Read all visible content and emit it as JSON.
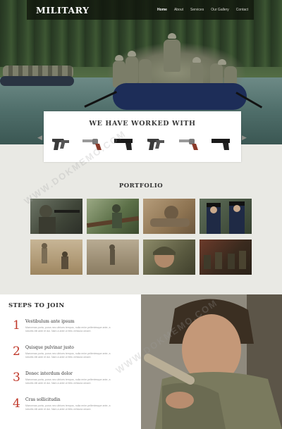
{
  "brand": "MILITARY",
  "nav": {
    "items": [
      "Home",
      "About",
      "Services",
      "Our Gallery",
      "Contact"
    ],
    "active_index": 0
  },
  "partners": {
    "title": "WE HAVE WORKED WITH",
    "logos": [
      "holster-pistol-icon",
      "revolver-icon",
      "pistol-icon",
      "holster-pistol-icon",
      "revolver-icon",
      "pistol-icon"
    ]
  },
  "portfolio": {
    "title": "PORTFOLIO",
    "thumbnails": [
      "soldier-aiming",
      "soldiers-forest",
      "soldier-crawling",
      "honor-guard",
      "desert-soldiers",
      "soldier-in-dust",
      "soldier-closeup",
      "troops-in-field"
    ]
  },
  "steps": {
    "title": "STEPS TO JOIN",
    "items": [
      {
        "num": "1",
        "title": "Vestibulum ante ipsum",
        "text": "Maecenas porta, purus nec ultrices tempus, nulla enim pellentesque ante, a lobortis elit ante et dui. Nam a ante ut felis vehicula ornare."
      },
      {
        "num": "2",
        "title": "Quisque pulvinar justo",
        "text": "Maecenas porta, purus nec ultrices tempus, nulla enim pellentesque ante, a lobortis elit ante et dui. Nam a ante ut felis vehicula ornare."
      },
      {
        "num": "3",
        "title": "Donec interdum dolor",
        "text": "Maecenas porta, purus nec ultrices tempus, nulla enim pellentesque ante, a lobortis elit ante et dui. Nam a ante ut felis vehicula ornare."
      },
      {
        "num": "4",
        "title": "Cras sollicitudin",
        "text": "Maecenas porta, purus nec ultrices tempus, nulla enim pellentesque ante, a lobortis elit ante et dui. Nam a ante ut felis vehicula ornare."
      }
    ]
  },
  "watermark": "WWW.DOKMEMO.COM",
  "colors": {
    "accent": "#c0392b",
    "nav_bg": "#1a2114",
    "section_bg": "#e9e9e4"
  }
}
